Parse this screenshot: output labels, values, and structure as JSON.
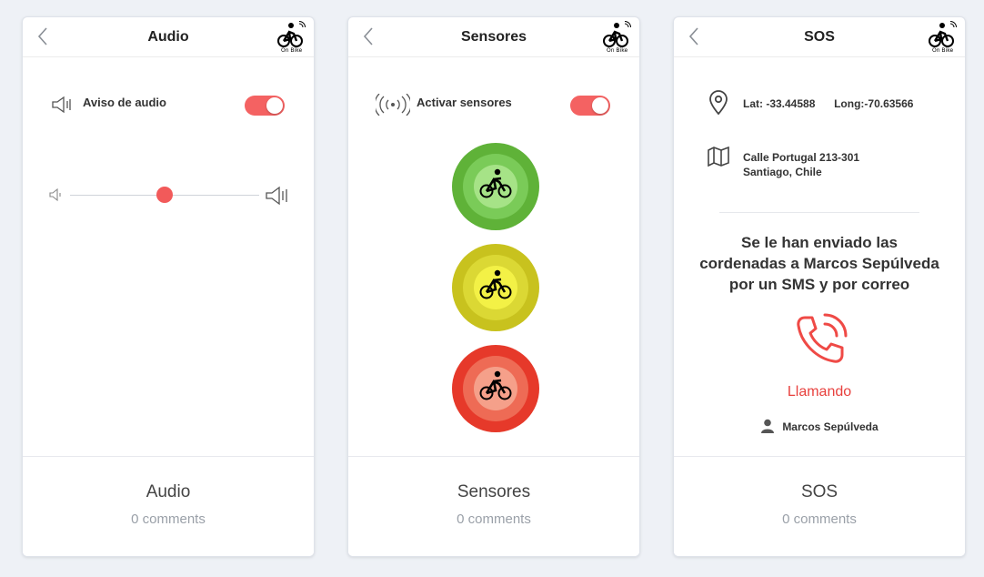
{
  "colors": {
    "accent_red": "#f46262",
    "green": "#5fb238",
    "yellow": "#c8c21e",
    "red": "#e6392a",
    "background": "#eef1f6"
  },
  "logo": {
    "text": "On Bike"
  },
  "cards": [
    {
      "header_title": "Audio",
      "footer_title": "Audio",
      "comments": "0 comments",
      "audio_warning_label": "Aviso de audio",
      "audio_warning_enabled": true,
      "volume_level": 0.5
    },
    {
      "header_title": "Sensores",
      "footer_title": "Sensores",
      "comments": "0 comments",
      "sensors_label": "Activar sensores",
      "sensors_enabled": true,
      "lights": [
        "green",
        "yellow",
        "red"
      ]
    },
    {
      "header_title": "SOS",
      "footer_title": "SOS",
      "comments": "0 comments",
      "lat": "Lat: -33.44588",
      "long": "Long:-70.63566",
      "address_line1": "Calle Portugal 213-301",
      "address_line2": "Santiago, Chile",
      "message_line1": "Se le han enviado las",
      "message_line2": "cordenadas a Marcos Sepúlveda",
      "message_line3": "por un SMS y por correo",
      "calling": "Llamando",
      "contact_name": "Marcos Sepúlveda"
    }
  ]
}
